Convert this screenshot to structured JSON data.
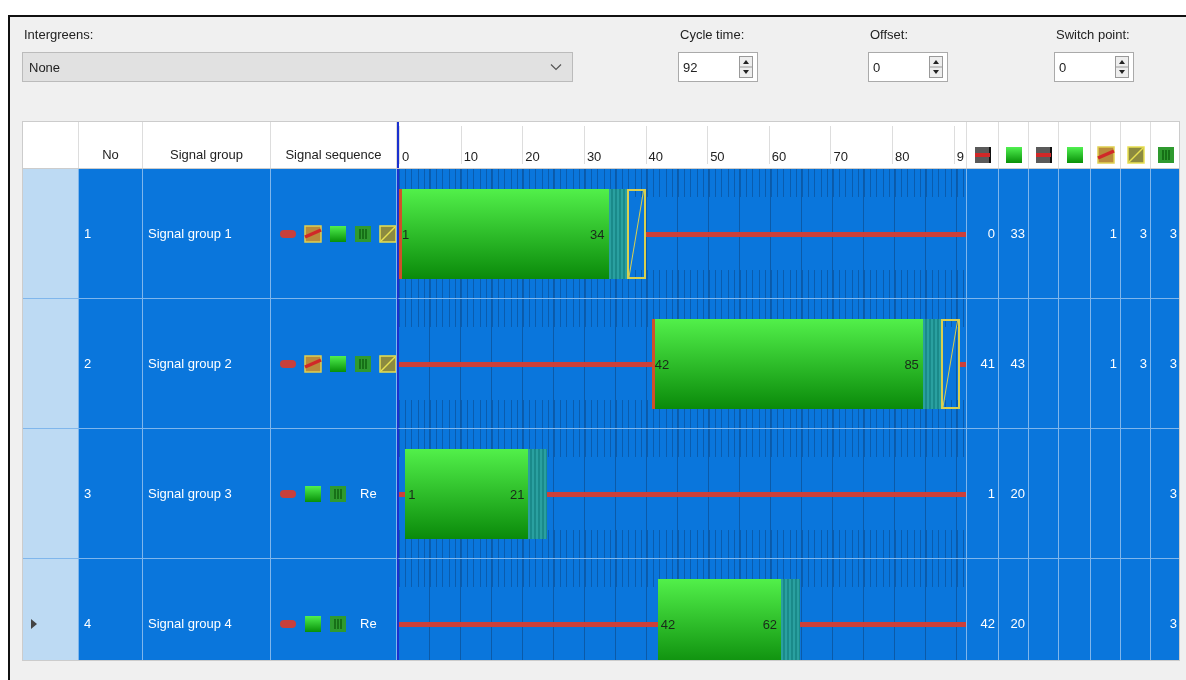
{
  "intergreens": {
    "label": "Intergreens:",
    "value": "None"
  },
  "cycle_time": {
    "label": "Cycle time:",
    "value": "92"
  },
  "offset": {
    "label": "Offset:",
    "value": "0"
  },
  "switch_point": {
    "label": "Switch point:",
    "value": "0"
  },
  "table": {
    "columns": [
      "No",
      "Signal group",
      "Signal sequence"
    ],
    "timeline_ticks": [
      "0",
      "10",
      "20",
      "30",
      "40",
      "50",
      "60",
      "70",
      "80",
      "9"
    ],
    "icon_columns": [
      {
        "kind": "red"
      },
      {
        "kind": "green"
      },
      {
        "kind": "red"
      },
      {
        "kind": "green"
      },
      {
        "kind": "red-amber"
      },
      {
        "kind": "amber"
      },
      {
        "kind": "flashing-green"
      }
    ],
    "rows": [
      {
        "no": "1",
        "name": "Signal group 1",
        "selected": false,
        "sequence": [
          {
            "kind": "red"
          },
          {
            "kind": "red-amber"
          },
          {
            "kind": "green"
          },
          {
            "kind": "flashing-green"
          },
          {
            "kind": "amber"
          }
        ],
        "green_start": "1",
        "green_end": "34",
        "timings": {
          "column_1": "0",
          "column_2": "33",
          "column_5": "1",
          "column_6": "3",
          "column_7": "3"
        }
      },
      {
        "no": "2",
        "name": "Signal group 2",
        "selected": false,
        "sequence": [
          {
            "kind": "red"
          },
          {
            "kind": "red-amber"
          },
          {
            "kind": "green"
          },
          {
            "kind": "flashing-green"
          },
          {
            "kind": "amber"
          }
        ],
        "green_start": "42",
        "green_end": "85",
        "timings": {
          "column_1": "41",
          "column_2": "43",
          "column_5": "1",
          "column_6": "3",
          "column_7": "3"
        }
      },
      {
        "no": "3",
        "name": "Signal group 3",
        "selected": false,
        "sequence": [
          {
            "kind": "red"
          },
          {
            "kind": "green"
          },
          {
            "kind": "flashing-green"
          }
        ],
        "sequence_label": "Re",
        "green_start": "1",
        "green_end": "21",
        "timings": {
          "column_1": "1",
          "column_2": "20",
          "column_7": "3"
        }
      },
      {
        "no": "4",
        "name": "Signal group 4",
        "selected": true,
        "sequence": [
          {
            "kind": "red"
          },
          {
            "kind": "green"
          },
          {
            "kind": "flashing-green"
          }
        ],
        "sequence_label": "Re",
        "green_start": "42",
        "green_end": "62",
        "timings": {
          "column_1": "42",
          "column_2": "20",
          "column_7": "3"
        }
      }
    ]
  }
}
